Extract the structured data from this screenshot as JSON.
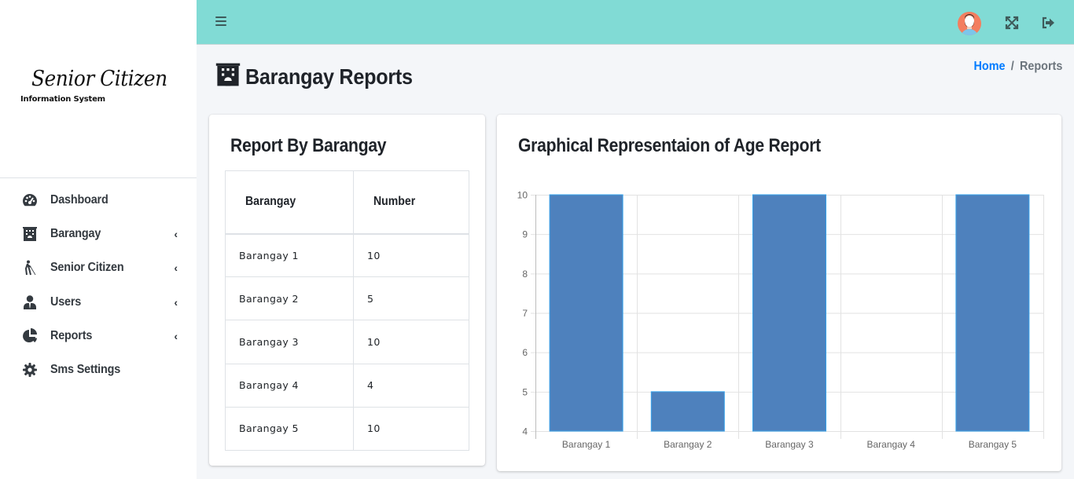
{
  "sidebar": {
    "logo_script": "Senior Citizen",
    "logo_sub": "Information System",
    "items": [
      {
        "label": "Dashboard",
        "icon": "tachometer-icon",
        "has_submenu": false
      },
      {
        "label": "Barangay",
        "icon": "building-icon",
        "has_submenu": true
      },
      {
        "label": "Senior Citizen",
        "icon": "blind-person-icon",
        "has_submenu": true
      },
      {
        "label": "Users",
        "icon": "user-tie-icon",
        "has_submenu": true
      },
      {
        "label": "Reports",
        "icon": "pie-chart-icon",
        "has_submenu": true
      },
      {
        "label": "Sms Settings",
        "icon": "gear-icon",
        "has_submenu": false
      }
    ],
    "chevron": "‹"
  },
  "topbar": {
    "menu_icon": "hamburger-icon",
    "avatar_icon": "user-avatar",
    "fullscreen_icon": "expand-icon",
    "logout_icon": "sign-out-icon",
    "color": "#81dbd5"
  },
  "page": {
    "title": "Barangay Reports",
    "breadcrumb": {
      "home": "Home",
      "separator": "/",
      "current": "Reports"
    }
  },
  "report_table": {
    "title": "Report By Barangay",
    "headers": [
      "Barangay",
      "Number"
    ],
    "rows": [
      [
        "Barangay 1",
        "10"
      ],
      [
        "Barangay 2",
        "5"
      ],
      [
        "Barangay 3",
        "10"
      ],
      [
        "Barangay 4",
        "4"
      ],
      [
        "Barangay 5",
        "10"
      ]
    ]
  },
  "chart_card": {
    "title": "Graphical Representaion of Age Report"
  },
  "chart_data": {
    "type": "bar",
    "title": "Graphical Representaion of Age Report",
    "categories": [
      "Barangay 1",
      "Barangay 2",
      "Barangay 3",
      "Barangay 4",
      "Barangay 5"
    ],
    "values": [
      10,
      5,
      10,
      4,
      10
    ],
    "xlabel": "",
    "ylabel": "",
    "ylim": [
      4,
      10
    ],
    "yticks": [
      4,
      5,
      6,
      7,
      8,
      9,
      10
    ],
    "grid": true,
    "legend": "none",
    "bar_color": "#4e81bd",
    "bar_border": "#36a2eb"
  }
}
